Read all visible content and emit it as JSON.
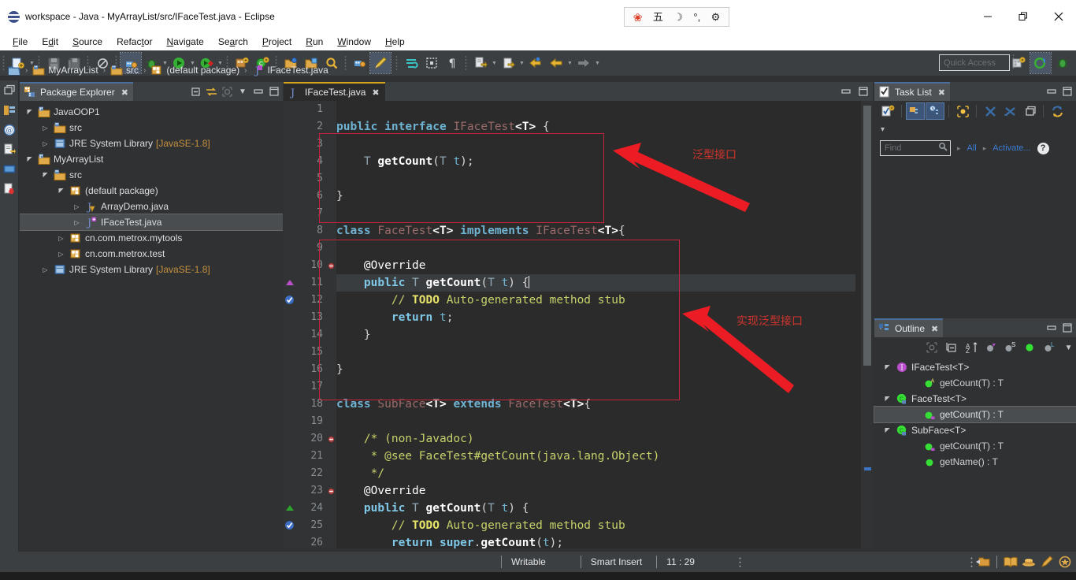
{
  "window": {
    "title": "workspace - Java - MyArrayList/src/IFaceTest.java - Eclipse",
    "minimize_label": "Minimize",
    "restore_label": "Restore",
    "close_label": "Close"
  },
  "ime": {
    "paw": "❀",
    "mode": "五",
    "moon": "☽",
    "punct": "°,",
    "gear": "⚙"
  },
  "menu": {
    "items": [
      "File",
      "Edit",
      "Source",
      "Refactor",
      "Navigate",
      "Search",
      "Project",
      "Run",
      "Window",
      "Help"
    ]
  },
  "toolbar": {
    "quick_access_placeholder": "Quick Access",
    "icons": [
      "new-file-icon",
      "save-icon",
      "save-all-icon",
      "skip-breakpoints-icon",
      "run-last-tool-icon",
      "debug-icon",
      "run-icon",
      "coverage-icon",
      "new-java-project-icon",
      "new-class-icon",
      "open-type-icon",
      "open-task-icon",
      "search-icon",
      "external-tools-icon",
      "edit-icon",
      "toggle-mark-occurrences-icon",
      "toggle-block-selection-icon",
      "show-whitespace-icon",
      "link-editor-icon",
      "next-annotation-icon",
      "previous-edit-icon",
      "back-icon",
      "forward-icon"
    ],
    "perspective_java_label": "Java",
    "perspective_debug_label": "Debug"
  },
  "breadcrumb": {
    "items": [
      "MyArrayList",
      "src",
      "(default package)",
      "IFaceTest.java"
    ],
    "separator": "›"
  },
  "package_explorer": {
    "title": "Package Explorer",
    "tools": [
      "collapse-all-icon",
      "link-with-editor-icon",
      "focus-on-active-task-icon",
      "view-menu-icon",
      "minimize-icon",
      "maximize-icon"
    ],
    "tree": [
      {
        "label": "JavaOOP1",
        "indent": 0,
        "arrow": "open",
        "icon": "java-project-icon",
        "selected": false
      },
      {
        "label": "src",
        "indent": 1,
        "arrow": "closed",
        "icon": "source-folder-icon",
        "selected": false
      },
      {
        "label": "JRE System Library",
        "suffix": " [JavaSE-1.8]",
        "indent": 1,
        "arrow": "closed",
        "icon": "library-icon",
        "selected": false
      },
      {
        "label": "MyArrayList",
        "indent": 0,
        "arrow": "open",
        "icon": "java-project-icon",
        "selected": false
      },
      {
        "label": "src",
        "indent": 1,
        "arrow": "open",
        "icon": "source-folder-icon",
        "selected": false
      },
      {
        "label": "(default package)",
        "indent": 2,
        "arrow": "open",
        "icon": "package-icon",
        "selected": false
      },
      {
        "label": "ArrayDemo.java",
        "indent": 3,
        "arrow": "closed",
        "icon": "java-warn-file-icon",
        "selected": false
      },
      {
        "label": "IFaceTest.java",
        "indent": 3,
        "arrow": "closed",
        "icon": "java-file-icon",
        "selected": true
      },
      {
        "label": "cn.com.metrox.mytools",
        "indent": 2,
        "arrow": "closed",
        "icon": "package-warn-icon",
        "selected": false
      },
      {
        "label": "cn.com.metrox.test",
        "indent": 2,
        "arrow": "closed",
        "icon": "package-warn-icon",
        "selected": false
      },
      {
        "label": "JRE System Library",
        "suffix": " [JavaSE-1.8]",
        "indent": 1,
        "arrow": "closed",
        "icon": "library-icon",
        "selected": false
      }
    ]
  },
  "editor": {
    "tab_label": "IFaceTest.java",
    "tab_icon": "java-file-icon",
    "tab_close": "✖",
    "tools": [
      "minimize-icon",
      "maximize-icon"
    ],
    "lines": [
      {
        "n": 1,
        "marker": "",
        "fold": "",
        "highlight": false
      },
      {
        "n": 2,
        "marker": "",
        "fold": "",
        "highlight": false
      },
      {
        "n": 3,
        "marker": "",
        "fold": "",
        "highlight": false
      },
      {
        "n": 4,
        "marker": "",
        "fold": "",
        "highlight": false
      },
      {
        "n": 5,
        "marker": "",
        "fold": "",
        "highlight": false
      },
      {
        "n": 6,
        "marker": "",
        "fold": "",
        "highlight": false
      },
      {
        "n": 7,
        "marker": "",
        "fold": "",
        "highlight": false
      },
      {
        "n": 8,
        "marker": "",
        "fold": "",
        "highlight": false
      },
      {
        "n": 9,
        "marker": "",
        "fold": "",
        "highlight": false
      },
      {
        "n": 10,
        "marker": "",
        "fold": "dot",
        "highlight": false
      },
      {
        "n": 11,
        "marker": "up-purple",
        "fold": "",
        "highlight": true
      },
      {
        "n": 12,
        "marker": "todo-blue",
        "fold": "",
        "highlight": false
      },
      {
        "n": 13,
        "marker": "",
        "fold": "",
        "highlight": false
      },
      {
        "n": 14,
        "marker": "",
        "fold": "",
        "highlight": false
      },
      {
        "n": 15,
        "marker": "",
        "fold": "",
        "highlight": false
      },
      {
        "n": 16,
        "marker": "",
        "fold": "",
        "highlight": false
      },
      {
        "n": 17,
        "marker": "",
        "fold": "",
        "highlight": false
      },
      {
        "n": 18,
        "marker": "",
        "fold": "",
        "highlight": false
      },
      {
        "n": 19,
        "marker": "",
        "fold": "",
        "highlight": false
      },
      {
        "n": 20,
        "marker": "",
        "fold": "dot",
        "highlight": false
      },
      {
        "n": 21,
        "marker": "",
        "fold": "",
        "highlight": false
      },
      {
        "n": 22,
        "marker": "",
        "fold": "",
        "highlight": false
      },
      {
        "n": 23,
        "marker": "",
        "fold": "dot",
        "highlight": false
      },
      {
        "n": 24,
        "marker": "up-green",
        "fold": "",
        "highlight": false
      },
      {
        "n": 25,
        "marker": "todo-blue",
        "fold": "",
        "highlight": false
      },
      {
        "n": 26,
        "marker": "",
        "fold": "",
        "highlight": false
      }
    ],
    "source": {
      "l1": "",
      "l2": "public interface IFaceTest<T> {",
      "l3": "",
      "l4": "    T getCount(T t);",
      "l5": "",
      "l6": "}",
      "l7": "",
      "l8": "class FaceTest<T> implements IFaceTest<T>{",
      "l9": "",
      "l10": "    @Override",
      "l11": "    public T getCount(T t) {",
      "l12": "        // TODO Auto-generated method stub",
      "l13": "        return t;",
      "l14": "    }",
      "l15": "",
      "l16": "}",
      "l17": "",
      "l18": "class SubFace<T> extends FaceTest<T>{",
      "l19": "",
      "l20": "    /* (non-Javadoc)",
      "l21": "     * @see FaceTest#getCount(java.lang.Object)",
      "l22": "     */",
      "l23": "    @Override",
      "l24": "    public T getCount(T t) {",
      "l25": "        // TODO Auto-generated method stub",
      "l26": "        return super.getCount(t);"
    }
  },
  "annotations": {
    "color": "#d0342c",
    "box_color": "#c5243a",
    "items": [
      {
        "text": "泛型接口",
        "name": "annotation-generic-interface"
      },
      {
        "text": "实现泛型接口",
        "name": "annotation-implement-generic-interface"
      }
    ]
  },
  "task_list": {
    "title": "Task List",
    "tools": [
      "new-task-icon",
      "categorized-presentation-icon",
      "scheduled-presentation-icon",
      "focus-on-workweek-icon",
      "collapse-all-icon",
      "expand-all-icon",
      "restore-tasks-icon",
      "synchronize-changed-icon"
    ],
    "find_placeholder": "Find",
    "find_value": "",
    "filter_all": "All",
    "filter_activate": "Activate...",
    "help_label": "?"
  },
  "outline": {
    "title": "Outline",
    "tools": [
      "focus-on-active-task-icon",
      "collapse-all-icon",
      "sort-icon",
      "hide-fields-icon",
      "hide-static-icon",
      "hide-non-public-icon",
      "hide-local-types-icon",
      "view-menu-icon"
    ],
    "tree": [
      {
        "label": "IFaceTest<T>",
        "indent": 0,
        "arrow": "open",
        "icon": "interface-icon",
        "selected": false
      },
      {
        "label": "getCount(T) : T",
        "indent": 1,
        "arrow": "none",
        "icon": "method-abstract-icon",
        "selected": false
      },
      {
        "label": "FaceTest<T>",
        "indent": 0,
        "arrow": "open",
        "icon": "class-icon",
        "selected": false
      },
      {
        "label": "getCount(T) : T",
        "indent": 1,
        "arrow": "none",
        "icon": "method-override-icon",
        "selected": true
      },
      {
        "label": "SubFace<T>",
        "indent": 0,
        "arrow": "open",
        "icon": "class-icon",
        "selected": false
      },
      {
        "label": "getCount(T) : T",
        "indent": 1,
        "arrow": "none",
        "icon": "method-override-icon",
        "selected": false
      },
      {
        "label": "getName() : T",
        "indent": 1,
        "arrow": "none",
        "icon": "method-icon",
        "selected": false
      }
    ]
  },
  "status_bar": {
    "writable": "Writable",
    "insert_mode": "Smart Insert",
    "cursor_position": "11 : 29",
    "right_icons": [
      "open-perspective-icon",
      "book-icon",
      "hat-icon",
      "pencil-icon",
      "shield-icon"
    ]
  },
  "colors": {
    "window_chrome": "#ffffff",
    "toolbar_bg": "#3c3f41",
    "panel_bg": "#2f3133",
    "editor_bg": "#2b2b2b",
    "selection": "#4a4d50",
    "line_highlight": "#3a3d3f",
    "keyword": "#cc7832",
    "modifier": "#7fc8e8",
    "type": "#9b6a6a",
    "comment": "#c8d06a",
    "method": "#ffffff",
    "line_number": "#888d91",
    "link": "#3b7bd4",
    "library_text": "#c6913f"
  }
}
